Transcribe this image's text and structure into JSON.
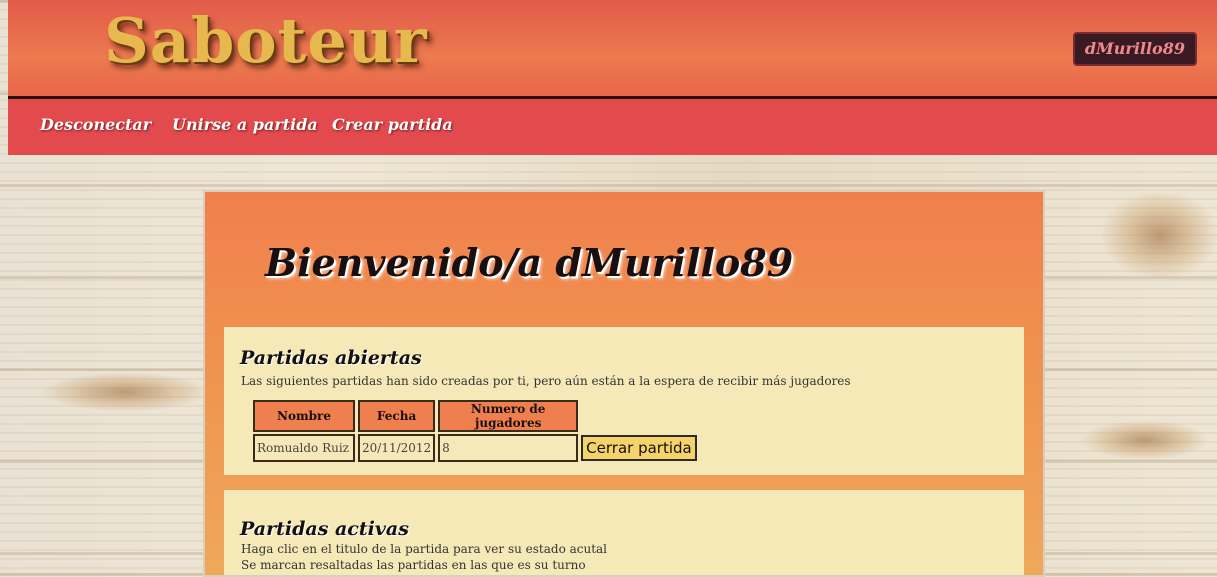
{
  "app": {
    "logo_text": "Saboteur",
    "user_badge": "dMurillo89"
  },
  "nav": {
    "items": [
      "Desconectar",
      "Unirse a partida",
      "Crear partida"
    ]
  },
  "welcome": {
    "title": "Bienvenido/a dMurillo89"
  },
  "open_games": {
    "title": "Partidas abiertas",
    "description": "Las siguientes partidas han sido creadas por ti, pero aún están a la espera de recibir más jugadores",
    "columns": [
      "Nombre",
      "Fecha",
      "Numero de jugadores"
    ],
    "rows": [
      {
        "nombre": "Romualdo Ruiz",
        "fecha": "20/11/2012",
        "jugadores": "8",
        "action": "Cerrar partida"
      }
    ]
  },
  "active_games": {
    "title": "Partidas activas",
    "line1": "Haga clic en el titulo de la partida para ver su estado acutal",
    "line2": "Se marcan resaltadas las partidas en las que es su turno"
  },
  "colors": {
    "header": "#e9664a",
    "menu": "#e24a4e",
    "logo": "#e7b84e",
    "table_header": "#ef7f4f",
    "card": "#f6e9b8"
  }
}
